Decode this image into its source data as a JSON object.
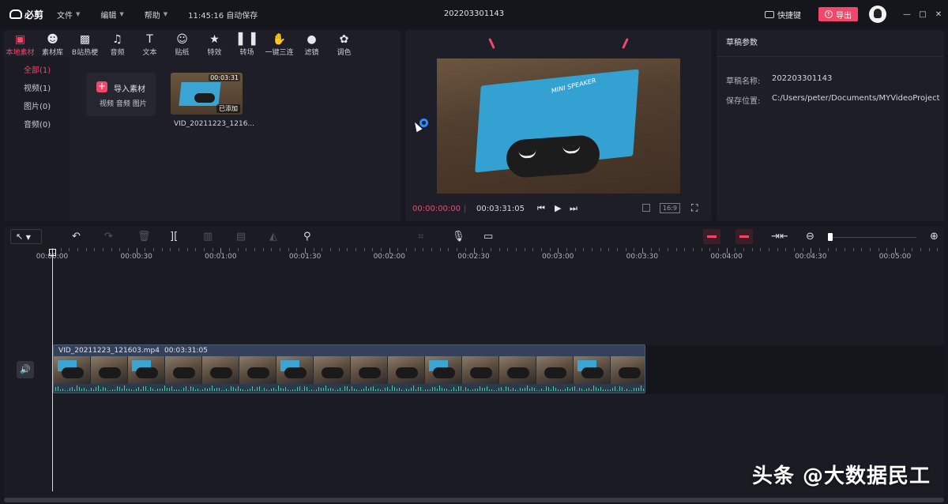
{
  "app": {
    "logo_text": "必剪",
    "doc_title": "202203301143",
    "autosave": "11:45:16 自动保存",
    "menu": [
      {
        "label": "文件"
      },
      {
        "label": "编辑"
      },
      {
        "label": "帮助"
      }
    ],
    "shortcut_label": "快捷键",
    "export_label": "导出",
    "window_controls": {
      "minimize": "—",
      "maximize": "□",
      "close": "✕"
    }
  },
  "media_tools": [
    {
      "label": "本地素材",
      "icon": "folder-upload-icon",
      "active": true
    },
    {
      "label": "素材库",
      "icon": "library-icon"
    },
    {
      "label": "B站热梗",
      "icon": "bilibili-tv-icon"
    },
    {
      "label": "音频",
      "icon": "music-note-icon"
    },
    {
      "label": "文本",
      "icon": "text-icon"
    },
    {
      "label": "贴纸",
      "icon": "sticker-icon"
    },
    {
      "label": "特效",
      "icon": "effects-star-icon"
    },
    {
      "label": "转场",
      "icon": "transition-icon"
    },
    {
      "label": "一键三连",
      "icon": "thumbs-up-icon"
    },
    {
      "label": "滤镜",
      "icon": "filter-icon"
    },
    {
      "label": "调色",
      "icon": "palette-icon"
    }
  ],
  "media_categories": [
    {
      "label": "全部(1)",
      "active": true
    },
    {
      "label": "视频(1)"
    },
    {
      "label": "图片(0)"
    },
    {
      "label": "音频(0)"
    }
  ],
  "import_card": {
    "title": "导入素材",
    "subtitle": "视频 音频 图片"
  },
  "media_item": {
    "duration": "00:03:31",
    "status": "已添加",
    "name": "VID_20211223_1216..."
  },
  "preview": {
    "current_time": "00:00:00:00",
    "separator": "|",
    "total_time": "00:03:31:05",
    "ratio": "16:9",
    "video_label": "MINI SPEAKER"
  },
  "params": {
    "title": "草稿参数",
    "rows": [
      {
        "key": "草稿名称:",
        "value": "202203301143"
      },
      {
        "key": "保存位置:",
        "value": "C:/Users/peter/Documents/MYVideoProject"
      }
    ]
  },
  "timeline": {
    "ruler_labels": [
      "00:00:00",
      "00:00:30",
      "00:01:00",
      "00:01:30",
      "00:02:00",
      "00:02:30",
      "00:03:00",
      "00:03:30",
      "00:04:00",
      "00:04:30",
      "00:05:00"
    ],
    "clip": {
      "name": "VID_20211223_121603.mp4",
      "duration": "00:03:31:05"
    },
    "zoom_level": 0.0
  },
  "watermark": "头条 @大数据民工"
}
